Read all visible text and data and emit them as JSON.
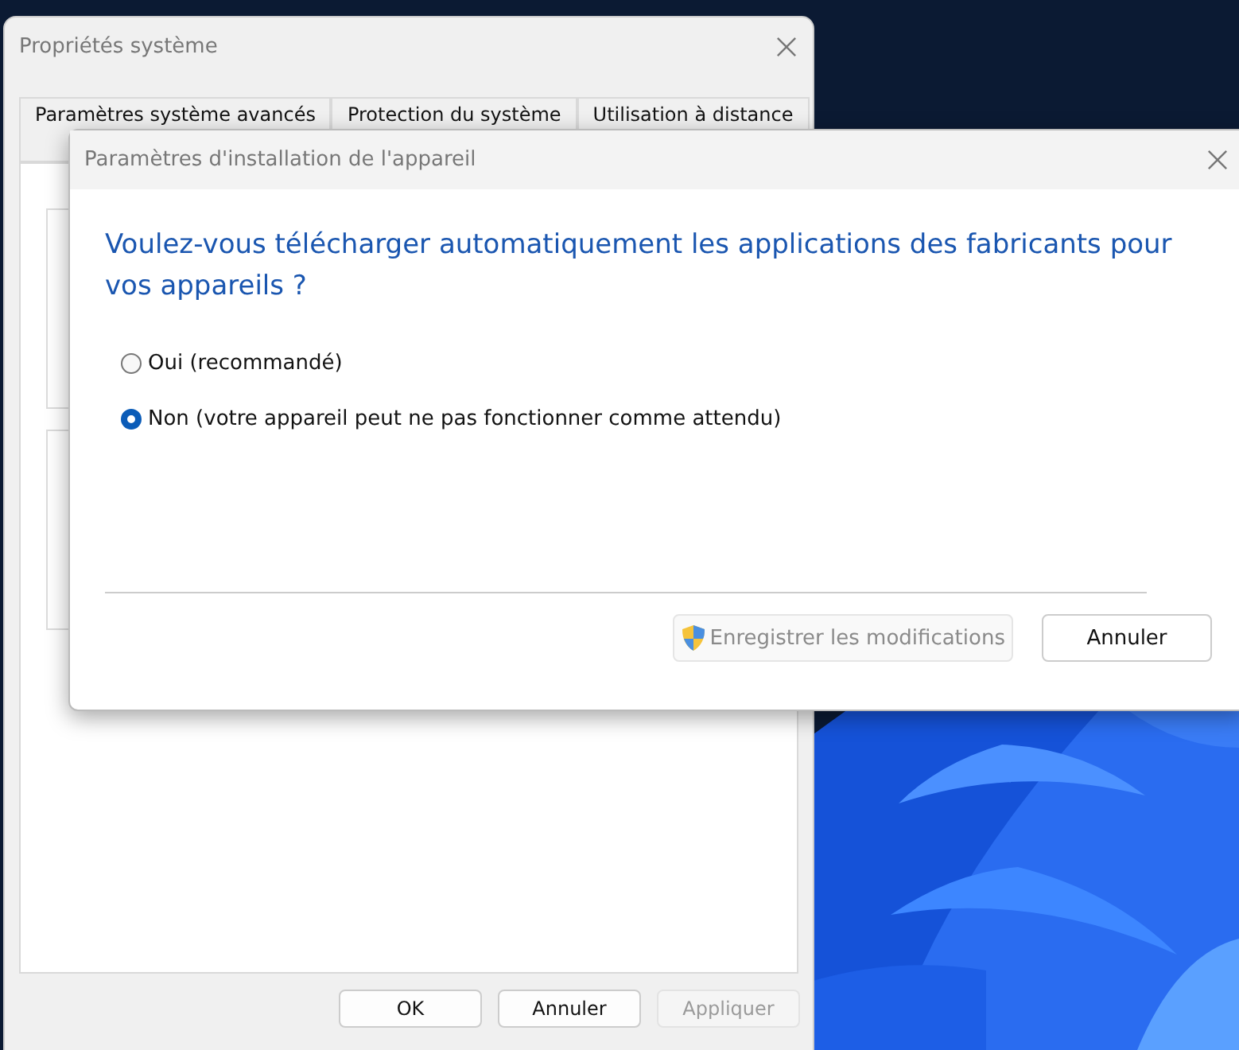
{
  "back_window": {
    "title": "Propriétés système",
    "tabs": [
      {
        "label": "Paramètres système avancés",
        "selected": false
      },
      {
        "label": "Protection du système",
        "selected": false
      },
      {
        "label": "Utilisation à distance",
        "selected": false
      }
    ],
    "buttons": [
      {
        "label": "OK",
        "disabled": false
      },
      {
        "label": "Annuler",
        "disabled": false
      },
      {
        "label": "Appliquer",
        "disabled": true
      }
    ]
  },
  "dialog": {
    "title": "Paramètres d'installation de l'appareil",
    "question": "Voulez-vous télécharger automatiquement les applications des fabricants pour vos appareils ?",
    "options": [
      {
        "label": "Oui (recommandé)",
        "selected": false
      },
      {
        "label": "Non (votre appareil peut ne pas fonctionner comme attendu)",
        "selected": true
      }
    ],
    "buttons": [
      {
        "kind": "shield",
        "label": "Enregistrer les modifications",
        "disabled": true
      },
      {
        "kind": "plain",
        "label": "Annuler",
        "disabled": false
      }
    ]
  }
}
